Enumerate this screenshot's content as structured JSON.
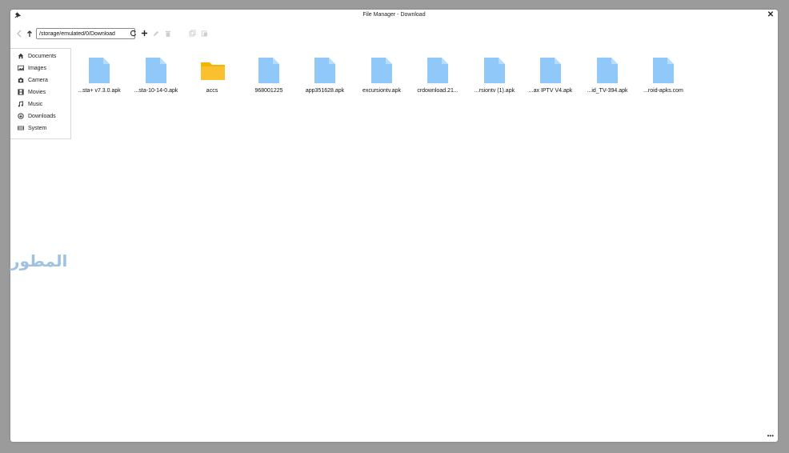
{
  "window": {
    "title": "File Manager - Download"
  },
  "toolbar": {
    "path_value": "/storage/emulated/0/Download"
  },
  "sidebar": {
    "items": [
      {
        "label": "Documents",
        "icon": "home-icon"
      },
      {
        "label": "Images",
        "icon": "image-icon"
      },
      {
        "label": "Camera",
        "icon": "camera-icon"
      },
      {
        "label": "Movies",
        "icon": "film-icon"
      },
      {
        "label": "Music",
        "icon": "music-icon"
      },
      {
        "label": "Downloads",
        "icon": "download-icon"
      },
      {
        "label": "System",
        "icon": "drive-icon"
      }
    ]
  },
  "files": [
    {
      "label": "...sta+ v7.3.0.apk",
      "type": "file"
    },
    {
      "label": "...sta-10-14-0.apk",
      "type": "file"
    },
    {
      "label": "accs",
      "type": "folder"
    },
    {
      "label": "968001225",
      "type": "file"
    },
    {
      "label": "app351628.apk",
      "type": "file"
    },
    {
      "label": "excursiontv.apk",
      "type": "file"
    },
    {
      "label": "crdownload.21...",
      "type": "file"
    },
    {
      "label": "...rsiontv (1).apk",
      "type": "file"
    },
    {
      "label": "...ax IPTV V4.apk",
      "type": "file"
    },
    {
      "label": "...id_TV-394.apk",
      "type": "file"
    },
    {
      "label": "...roid-apks.com",
      "type": "file"
    }
  ],
  "watermark": {
    "text": "المطور"
  },
  "colors": {
    "file_icon": "#90c9f9",
    "folder_icon": "#fbc02d"
  }
}
